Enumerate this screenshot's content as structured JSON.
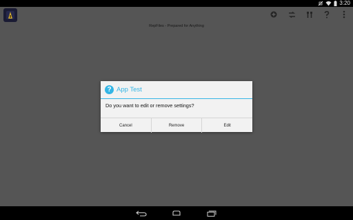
{
  "status_bar": {
    "time": "3:20",
    "icons": [
      "no-sim-icon",
      "wifi-icon",
      "battery-icon"
    ]
  },
  "action_bar": {
    "app_icon": "app-logo-icon",
    "actions": [
      "add-icon",
      "switch-icon",
      "tools-icon",
      "help-icon",
      "overflow-menu-icon"
    ],
    "subtitle": "RepFiles - Prepared for Anything"
  },
  "dialog": {
    "icon": "question-icon",
    "icon_glyph": "?",
    "title": "App Test",
    "message": "Do you want to edit or remove settings?",
    "buttons": {
      "cancel": "Cancel",
      "remove": "Remove",
      "edit": "Edit"
    },
    "accent_color": "#33b5e5"
  },
  "nav_bar": {
    "buttons": [
      "back-icon",
      "home-icon",
      "recent-apps-icon"
    ]
  }
}
